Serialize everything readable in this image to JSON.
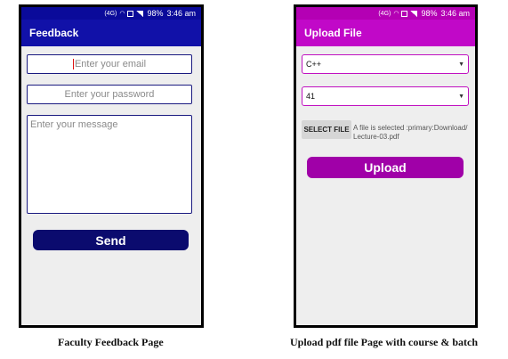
{
  "feedback_screen": {
    "status": {
      "battery_percent": "98%",
      "time": "3:46 am"
    },
    "toolbar_title": "Feedback",
    "email_placeholder": "Enter your email",
    "password_placeholder": "Enter your password",
    "message_placeholder": "Enter your message",
    "send_label": "Send",
    "colors": {
      "status_bar": "#0a0a9a",
      "toolbar": "#1111a8",
      "button": "#0b0b6e",
      "input_border": "#1a1a80"
    }
  },
  "upload_screen": {
    "status": {
      "battery_percent": "98%",
      "time": "3:46 am"
    },
    "toolbar_title": "Upload File",
    "course_value": "C++",
    "batch_value": "41",
    "select_file_label": "SELECT FILE",
    "file_status": "A file is selected :primary:Download/ Lecture-03.pdf",
    "upload_label": "Upload",
    "colors": {
      "status_bar": "#b400b4",
      "toolbar": "#c108c8",
      "button": "#a000a8",
      "select_border": "#c111c1"
    }
  },
  "captions": {
    "left": "Faculty Feedback Page",
    "right": "Upload pdf file Page with course & batch"
  }
}
